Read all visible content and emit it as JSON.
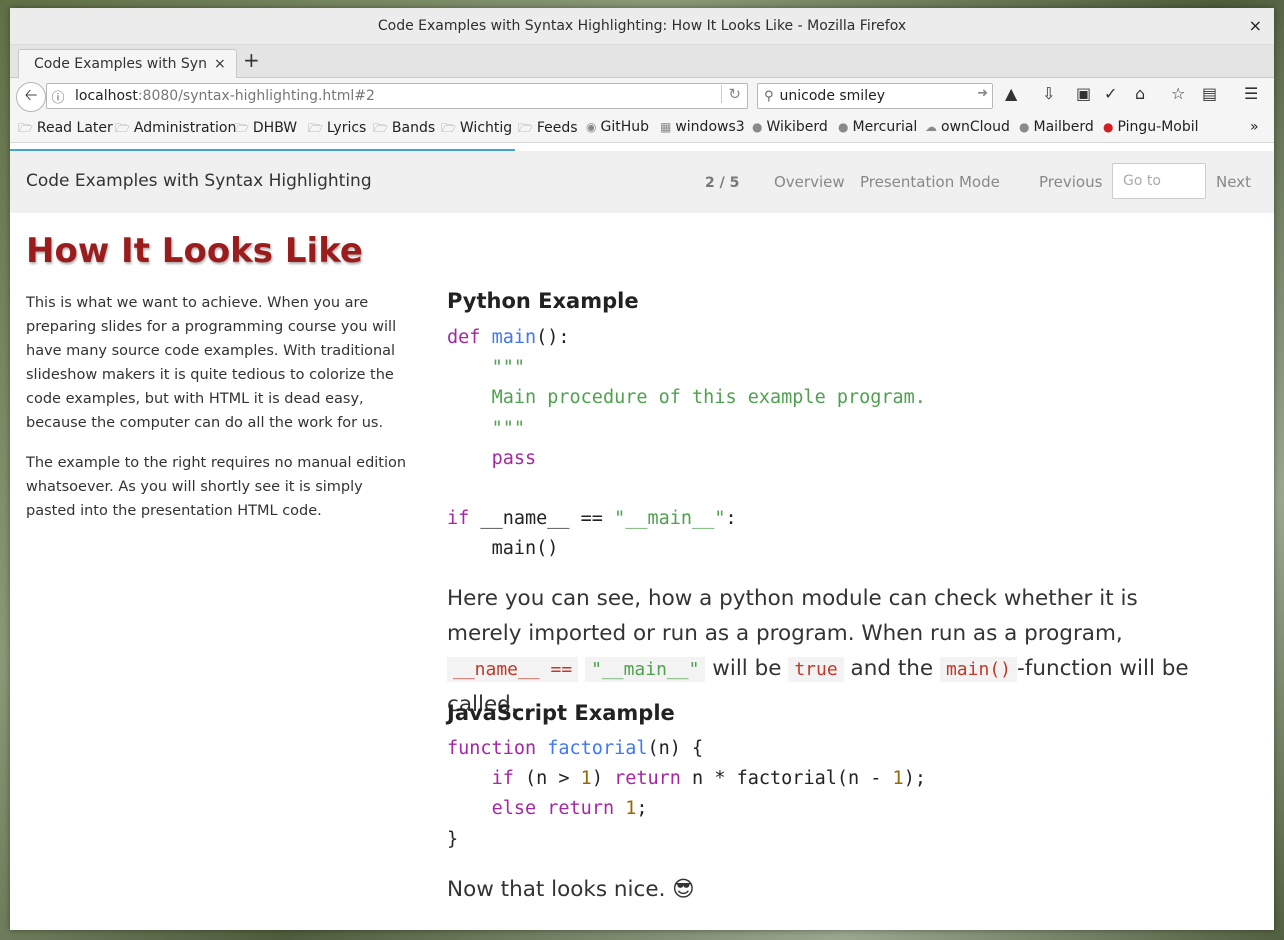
{
  "window": {
    "title": "Code Examples with Syntax Highlighting: How It Looks Like - Mozilla Firefox",
    "close": "×"
  },
  "tab": {
    "label": "Code Examples with Syntax Highlighting: How It Looks Like",
    "close": "×",
    "new": "+"
  },
  "nav": {
    "url_host": "localhost",
    "url_path": ":8080/syntax-highlighting.html#2",
    "search_value": "unicode smiley"
  },
  "bookmarks": [
    {
      "label": "Read Later",
      "icon": "folder-icon"
    },
    {
      "label": "Administration",
      "icon": "folder-icon"
    },
    {
      "label": "DHBW",
      "icon": "folder-icon"
    },
    {
      "label": "Lyrics",
      "icon": "folder-icon"
    },
    {
      "label": "Bands",
      "icon": "folder-icon"
    },
    {
      "label": "Wichtig",
      "icon": "folder-icon"
    },
    {
      "label": "Feeds",
      "icon": "folder-icon"
    },
    {
      "label": "GitHub",
      "icon": "github-icon"
    },
    {
      "label": "windows3",
      "icon": "site-icon"
    },
    {
      "label": "Wikiberd",
      "icon": "site-icon"
    },
    {
      "label": "Mercurial",
      "icon": "site-icon"
    },
    {
      "label": "ownCloud",
      "icon": "site-icon"
    },
    {
      "label": "Mailberd",
      "icon": "site-icon"
    },
    {
      "label": "Pingu-Mobil",
      "icon": "site-icon"
    }
  ],
  "header": {
    "title": "Code Examples with Syntax Highlighting",
    "counter": "2 / 5",
    "overview": "Overview",
    "presentation_mode": "Presentation Mode",
    "previous": "Previous",
    "goto_placeholder": "Go to",
    "next": "Next"
  },
  "slide": {
    "title": "How It Looks Like",
    "intro": "This is what we want to achieve. When you are preparing slides for a programming course you will have many source code examples. With traditional slideshow makers it is quite tedious to colorize the code examples, but with HTML it is dead easy, because the computer can do all the work for us.",
    "intro2": "The example to the right requires no manual edition whatsoever. As you will shortly see it is simply pasted into the presentation HTML code.",
    "python_heading": "Python Example",
    "py": {
      "def": "def",
      "main": "main",
      "parens": "():",
      "docq": "\"\"\"",
      "doc": "Main procedure of this example program.",
      "pass": "pass",
      "if": "if",
      "name_cmp": "__name__ == ",
      "main_str": "\"__main__\"",
      "colon": ":",
      "call": "main()"
    },
    "para1": {
      "a": "Here you can see, how a python module can check whether it is merely imported or run as a program. When run as a program,",
      "code1": "__name__ ==",
      "code2": "\"__main__\"",
      "b": "will be",
      "code3": "true",
      "c": "and the",
      "code4": "main()",
      "d": "-function will be called."
    },
    "js_heading": "JavaScript Example",
    "js": {
      "function": "function",
      "factorial": "factorial",
      "sig": "(n) {",
      "if": "if",
      "cond_a": " (n > ",
      "one": "1",
      "cond_b": ") ",
      "return": "return",
      "expr_a": " n * factorial(n - ",
      "expr_b": ");",
      "else": "else",
      "else_ret": "return",
      "semi": ";",
      "close": "}"
    },
    "closing": "Now that looks nice. 😎"
  }
}
